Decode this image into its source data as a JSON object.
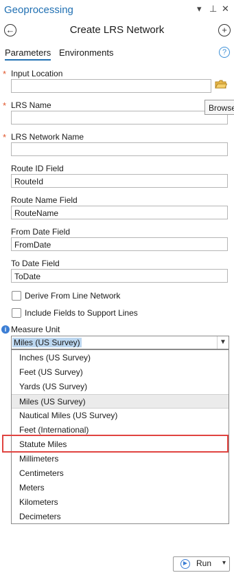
{
  "pane": {
    "title": "Geoprocessing",
    "menu_icon": "▾",
    "pin_icon": "⊥",
    "close_icon": "✕"
  },
  "header": {
    "back_icon": "←",
    "title": "Create LRS Network",
    "add_icon": "+"
  },
  "tabs": [
    {
      "label": "Parameters",
      "active": true
    },
    {
      "label": "Environments",
      "active": false
    }
  ],
  "help_icon": "?",
  "params": {
    "input_location": {
      "label": "Input Location",
      "value": "",
      "required": true
    },
    "lrs_name": {
      "label": "LRS Name",
      "value": "",
      "required": true
    },
    "lrs_network_name": {
      "label": "LRS Network Name",
      "value": "",
      "required": true
    },
    "route_id_field": {
      "label": "Route ID Field",
      "value": "RouteId"
    },
    "route_name_field": {
      "label": "Route Name Field",
      "value": "RouteName"
    },
    "from_date_field": {
      "label": "From Date Field",
      "value": "FromDate"
    },
    "to_date_field": {
      "label": "To Date Field",
      "value": "ToDate"
    },
    "derive_from_line_network": {
      "label": "Derive From Line Network",
      "checked": false
    },
    "include_fields": {
      "label": "Include Fields to Support Lines",
      "checked": false
    },
    "measure_unit": {
      "label": "Measure Unit",
      "value": "Miles (US Survey)"
    }
  },
  "required_marker": "*",
  "info_icon": "i",
  "tooltip": "Browse",
  "measure_unit_options": [
    "Inches (US Survey)",
    "Feet (US Survey)",
    "Yards (US Survey)",
    "Miles (US Survey)",
    "Nautical Miles (US Survey)",
    "Feet (International)",
    "Statute Miles",
    "Millimeters",
    "Centimeters",
    "Meters",
    "Kilometers",
    "Decimeters"
  ],
  "run_button": {
    "label": "Run",
    "arrow": "▾"
  },
  "colors": {
    "accent": "#1f6fb2",
    "highlight": "#e0433f",
    "required": "#e0552b"
  }
}
